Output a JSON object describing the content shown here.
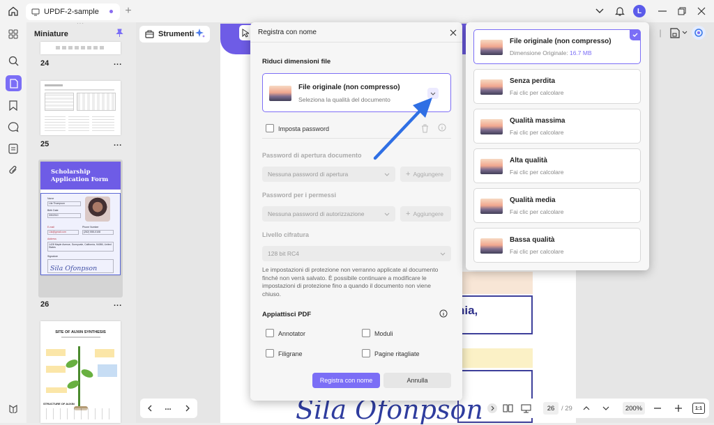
{
  "app": {
    "tab_title": "UPDF-2-sample",
    "avatar_initial": "L"
  },
  "sidebar": {
    "title": "Miniature",
    "pages": [
      {
        "num": "24"
      },
      {
        "num": "25"
      },
      {
        "num": "26"
      }
    ],
    "more": "..."
  },
  "thumb26": {
    "title": "Scholarship Application Form",
    "name_label": "Name",
    "name_value": "Lila Thompson",
    "birth_label": "Birth Date",
    "birth_value": "3/5/2010",
    "email_label": "E-mail",
    "email_value": "Lila@gmail.com",
    "phone_label": "Phone Number",
    "phone_value": "(262) 555-0108",
    "address_label": "Address",
    "address_value": "1428 Maple Avenue, Sunnyvale, California, 94086, United States",
    "signature_label": "Signature",
    "signature": "Sila Ofonpson"
  },
  "thumb27": {
    "title": "SITE OF AUXIN SYNTHESIS",
    "structure_label": "STRUCTURE OF AUXIN"
  },
  "toolbar": {
    "strumenti": "Strumenti"
  },
  "dialog": {
    "title": "Registra con nome",
    "reduce_label": "Riduci dimensioni file",
    "selected_title": "File originale (non compresso)",
    "selected_sub": "Seleziona la qualità del documento",
    "set_password": "Imposta password",
    "open_pw_label": "Password di apertura documento",
    "open_pw_placeholder": "Nessuna password di apertura",
    "add": "Aggiungere",
    "perm_pw_label": "Password per i permessi",
    "perm_pw_placeholder": "Nessuna password di autorizzazione",
    "enc_label": "Livello cifratura",
    "enc_value": "128 bit RC4",
    "notice": "Le impostazioni di protezione non verranno applicate al documento finché non verrà salvato. È possibile continuare a modificare le impostazioni di protezione fino a quando il documento non viene chiuso.",
    "flatten_label": "Appiattisci PDF",
    "flatten_options": [
      "Annotator",
      "Moduli",
      "Filigrane",
      "Pagine ritagliate"
    ],
    "save_btn": "Registra con nome",
    "cancel_btn": "Annulla"
  },
  "quality": {
    "items": [
      {
        "title": "File originale (non compresso)",
        "sub_prefix": "Dimensione Originale: ",
        "sub_value": "16.7 MB"
      },
      {
        "title": "Senza perdita",
        "sub": "Fai clic per calcolare"
      },
      {
        "title": "Qualità massima",
        "sub": "Fai clic per calcolare"
      },
      {
        "title": "Alta qualità",
        "sub": "Fai clic per calcolare"
      },
      {
        "title": "Qualità media",
        "sub": "Fai clic per calcolare"
      },
      {
        "title": "Bassa qualità",
        "sub": "Fai clic per calcolare"
      }
    ]
  },
  "document": {
    "fragment1": "nia,",
    "signature": "Sila Ofonpson"
  },
  "bottombar": {
    "page_current": "26",
    "page_total": "/ 29",
    "zoom": "200%",
    "fit": "1:1",
    "nav_dots": "..."
  },
  "colors": {
    "accent": "#7b6ef6",
    "arrow": "#2f6fe4",
    "thumb_header": "#6e5ce6"
  }
}
